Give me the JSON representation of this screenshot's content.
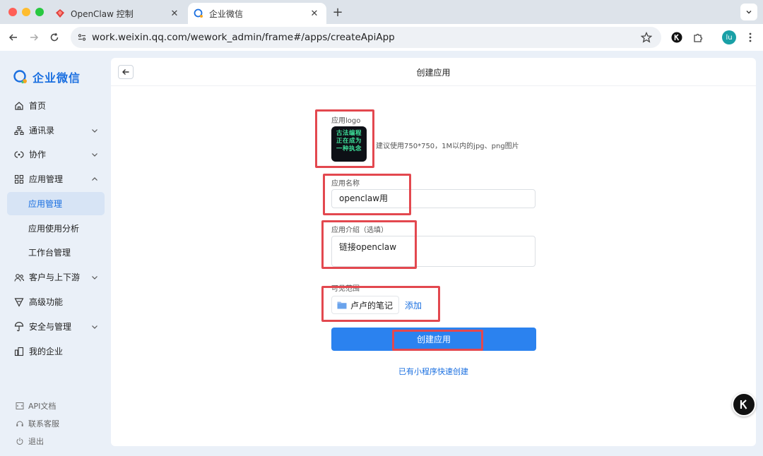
{
  "browser": {
    "tabs": [
      {
        "title": "OpenClaw 控制",
        "active": false
      },
      {
        "title": "企业微信",
        "active": true
      }
    ],
    "url": "work.weixin.qq.com/wework_admin/frame#/apps/createApiApp",
    "profile_initials": "lu"
  },
  "sidebar": {
    "brand": "企业微信",
    "items": [
      {
        "label": "首页",
        "icon": "home-icon"
      },
      {
        "label": "通讯录",
        "icon": "org-chart-icon",
        "chevron": "down"
      },
      {
        "label": "协作",
        "icon": "collaboration-icon",
        "chevron": "down"
      },
      {
        "label": "应用管理",
        "icon": "apps-grid-icon",
        "chevron": "up"
      },
      {
        "label": "应用管理",
        "sub": true,
        "active": true
      },
      {
        "label": "应用使用分析",
        "sub": true
      },
      {
        "label": "工作台管理",
        "sub": true
      },
      {
        "label": "客户与上下游",
        "icon": "customers-icon",
        "chevron": "down"
      },
      {
        "label": "高级功能",
        "icon": "advanced-icon"
      },
      {
        "label": "安全与管理",
        "icon": "security-icon",
        "chevron": "down"
      },
      {
        "label": "我的企业",
        "icon": "enterprise-icon"
      }
    ],
    "footer": [
      {
        "label": "API文档",
        "icon": "api-doc-icon"
      },
      {
        "label": "联系客服",
        "icon": "headset-icon"
      },
      {
        "label": "退出",
        "icon": "power-icon"
      }
    ]
  },
  "form": {
    "title": "创建应用",
    "logo_label": "应用logo",
    "logo_text": [
      "古法编程",
      "正在成为",
      "一种执念"
    ],
    "logo_hint": "建议使用750*750，1M以内的jpg、png图片",
    "name_label": "应用名称",
    "name_value": "openclaw用",
    "desc_label": "应用介绍（选填）",
    "desc_value": "链接openclaw",
    "scope_label": "可见范围",
    "scope_value": "卢卢的笔记",
    "add_label": "添加",
    "submit_label": "创建应用",
    "mini_program_link": "已有小程序快速创建"
  },
  "colors": {
    "accent": "#2b82ef",
    "highlight": "#e3484f",
    "sidebar_active_bg": "#d7e4f5"
  }
}
